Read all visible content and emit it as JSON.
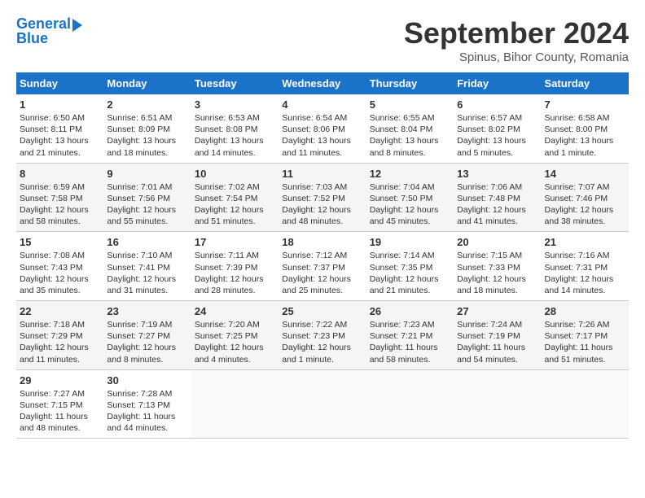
{
  "header": {
    "logo_line1": "General",
    "logo_line2": "Blue",
    "month": "September 2024",
    "location": "Spinus, Bihor County, Romania"
  },
  "weekdays": [
    "Sunday",
    "Monday",
    "Tuesday",
    "Wednesday",
    "Thursday",
    "Friday",
    "Saturday"
  ],
  "weeks": [
    [
      {
        "day": "1",
        "info": "Sunrise: 6:50 AM\nSunset: 8:11 PM\nDaylight: 13 hours\nand 21 minutes."
      },
      {
        "day": "2",
        "info": "Sunrise: 6:51 AM\nSunset: 8:09 PM\nDaylight: 13 hours\nand 18 minutes."
      },
      {
        "day": "3",
        "info": "Sunrise: 6:53 AM\nSunset: 8:08 PM\nDaylight: 13 hours\nand 14 minutes."
      },
      {
        "day": "4",
        "info": "Sunrise: 6:54 AM\nSunset: 8:06 PM\nDaylight: 13 hours\nand 11 minutes."
      },
      {
        "day": "5",
        "info": "Sunrise: 6:55 AM\nSunset: 8:04 PM\nDaylight: 13 hours\nand 8 minutes."
      },
      {
        "day": "6",
        "info": "Sunrise: 6:57 AM\nSunset: 8:02 PM\nDaylight: 13 hours\nand 5 minutes."
      },
      {
        "day": "7",
        "info": "Sunrise: 6:58 AM\nSunset: 8:00 PM\nDaylight: 13 hours\nand 1 minute."
      }
    ],
    [
      {
        "day": "8",
        "info": "Sunrise: 6:59 AM\nSunset: 7:58 PM\nDaylight: 12 hours\nand 58 minutes."
      },
      {
        "day": "9",
        "info": "Sunrise: 7:01 AM\nSunset: 7:56 PM\nDaylight: 12 hours\nand 55 minutes."
      },
      {
        "day": "10",
        "info": "Sunrise: 7:02 AM\nSunset: 7:54 PM\nDaylight: 12 hours\nand 51 minutes."
      },
      {
        "day": "11",
        "info": "Sunrise: 7:03 AM\nSunset: 7:52 PM\nDaylight: 12 hours\nand 48 minutes."
      },
      {
        "day": "12",
        "info": "Sunrise: 7:04 AM\nSunset: 7:50 PM\nDaylight: 12 hours\nand 45 minutes."
      },
      {
        "day": "13",
        "info": "Sunrise: 7:06 AM\nSunset: 7:48 PM\nDaylight: 12 hours\nand 41 minutes."
      },
      {
        "day": "14",
        "info": "Sunrise: 7:07 AM\nSunset: 7:46 PM\nDaylight: 12 hours\nand 38 minutes."
      }
    ],
    [
      {
        "day": "15",
        "info": "Sunrise: 7:08 AM\nSunset: 7:43 PM\nDaylight: 12 hours\nand 35 minutes."
      },
      {
        "day": "16",
        "info": "Sunrise: 7:10 AM\nSunset: 7:41 PM\nDaylight: 12 hours\nand 31 minutes."
      },
      {
        "day": "17",
        "info": "Sunrise: 7:11 AM\nSunset: 7:39 PM\nDaylight: 12 hours\nand 28 minutes."
      },
      {
        "day": "18",
        "info": "Sunrise: 7:12 AM\nSunset: 7:37 PM\nDaylight: 12 hours\nand 25 minutes."
      },
      {
        "day": "19",
        "info": "Sunrise: 7:14 AM\nSunset: 7:35 PM\nDaylight: 12 hours\nand 21 minutes."
      },
      {
        "day": "20",
        "info": "Sunrise: 7:15 AM\nSunset: 7:33 PM\nDaylight: 12 hours\nand 18 minutes."
      },
      {
        "day": "21",
        "info": "Sunrise: 7:16 AM\nSunset: 7:31 PM\nDaylight: 12 hours\nand 14 minutes."
      }
    ],
    [
      {
        "day": "22",
        "info": "Sunrise: 7:18 AM\nSunset: 7:29 PM\nDaylight: 12 hours\nand 11 minutes."
      },
      {
        "day": "23",
        "info": "Sunrise: 7:19 AM\nSunset: 7:27 PM\nDaylight: 12 hours\nand 8 minutes."
      },
      {
        "day": "24",
        "info": "Sunrise: 7:20 AM\nSunset: 7:25 PM\nDaylight: 12 hours\nand 4 minutes."
      },
      {
        "day": "25",
        "info": "Sunrise: 7:22 AM\nSunset: 7:23 PM\nDaylight: 12 hours\nand 1 minute."
      },
      {
        "day": "26",
        "info": "Sunrise: 7:23 AM\nSunset: 7:21 PM\nDaylight: 11 hours\nand 58 minutes."
      },
      {
        "day": "27",
        "info": "Sunrise: 7:24 AM\nSunset: 7:19 PM\nDaylight: 11 hours\nand 54 minutes."
      },
      {
        "day": "28",
        "info": "Sunrise: 7:26 AM\nSunset: 7:17 PM\nDaylight: 11 hours\nand 51 minutes."
      }
    ],
    [
      {
        "day": "29",
        "info": "Sunrise: 7:27 AM\nSunset: 7:15 PM\nDaylight: 11 hours\nand 48 minutes."
      },
      {
        "day": "30",
        "info": "Sunrise: 7:28 AM\nSunset: 7:13 PM\nDaylight: 11 hours\nand 44 minutes."
      },
      {
        "day": "",
        "info": ""
      },
      {
        "day": "",
        "info": ""
      },
      {
        "day": "",
        "info": ""
      },
      {
        "day": "",
        "info": ""
      },
      {
        "day": "",
        "info": ""
      }
    ]
  ]
}
